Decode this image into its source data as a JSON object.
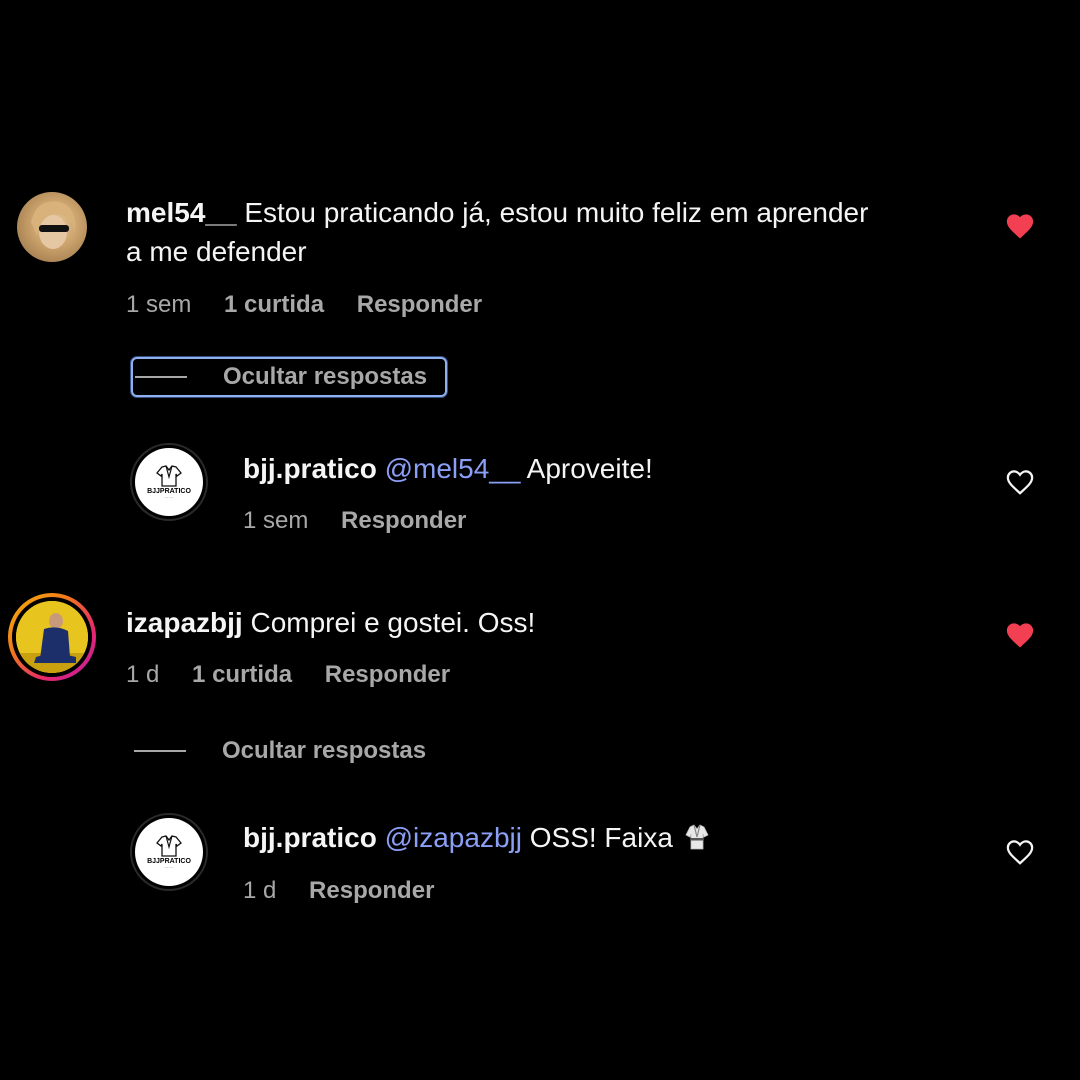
{
  "comments": [
    {
      "username": "mel54__",
      "text": "Estou praticando já, estou muito feliz em aprender",
      "text_line2": "a me defender",
      "time": "1 sem",
      "likes": "1 curtida",
      "reply_label": "Responder",
      "liked": true,
      "hide_replies_label": "Ocultar respostas",
      "reply": {
        "username": "bjj.pratico",
        "mention": "@mel54__",
        "text": "Aproveite!",
        "time": "1 sem",
        "reply_label": "Responder",
        "liked": false
      }
    },
    {
      "username": "izapazbjj",
      "text": "Comprei e gostei. Oss!",
      "time": "1 d",
      "likes": "1 curtida",
      "reply_label": "Responder",
      "liked": true,
      "hide_replies_label": "Ocultar respostas",
      "reply": {
        "username": "bjj.pratico",
        "mention": "@izapazbjj",
        "text": "OSS! Faixa",
        "time": "1 d",
        "reply_label": "Responder",
        "liked": false
      }
    }
  ],
  "brand_logo_text": "BJJPRATICO",
  "colors": {
    "background": "#000000",
    "mention": "#8b9ff5",
    "liked_heart": "#f23f52",
    "secondary_text": "#a8a8a8",
    "focus_outline": "#8fb0f0"
  }
}
